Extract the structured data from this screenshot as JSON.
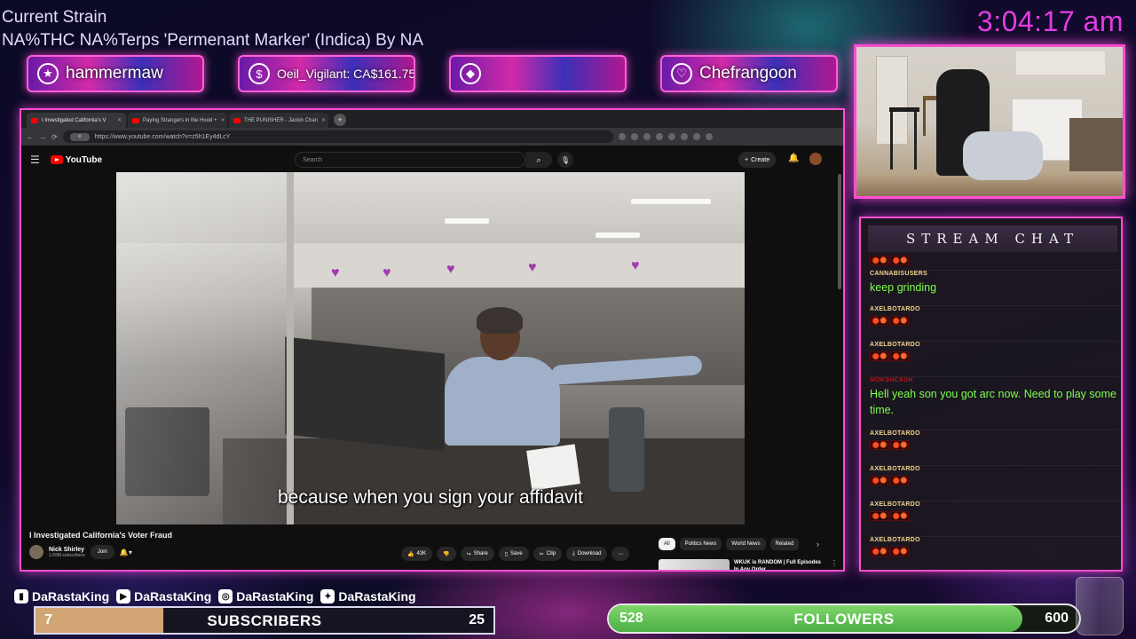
{
  "overlay": {
    "strain_title": "Current Strain",
    "strain_desc": "NA%THC NA%Terps 'Permenant Marker' (Indica) By NA",
    "clock": "3:04:17 am"
  },
  "alerts": [
    {
      "icon": "star-icon",
      "glyph": "★",
      "label": "hammermaw"
    },
    {
      "icon": "dollar-icon",
      "glyph": "$",
      "label": "Oeil_Vigilant: CA$161.75"
    },
    {
      "icon": "diamond-icon",
      "glyph": "◆",
      "label": ""
    },
    {
      "icon": "heart-icon",
      "glyph": "♡",
      "label": "Chefrangoon"
    }
  ],
  "browser": {
    "tabs": [
      {
        "label": "I Investigated California's V",
        "active": true
      },
      {
        "label": "Paying Strangers in the Hood +",
        "active": false
      },
      {
        "label": "THE PUNISHER - Jackin Chan",
        "active": false
      }
    ],
    "url": "https://www.youtube.com/watch?v=z5h1Ey4dLcY",
    "nav_back": "←",
    "nav_forward": "→",
    "nav_reload": "⟳"
  },
  "youtube": {
    "logo": "YouTube",
    "search_placeholder": "Search",
    "create_label": "Create",
    "subtitle": "because when you sign your affidavit",
    "video_title": "I Investigated California's Voter Fraud",
    "channel_name": "Nick Shirley",
    "channel_subs": "1.69M subscribers",
    "join_label": "Join",
    "likes": "43K",
    "share_label": "Share",
    "save_label": "Save",
    "clip_label": "Clip",
    "download_label": "Download",
    "chips": [
      "All",
      "Politics News",
      "World News",
      "Related"
    ],
    "reco_title": "WKUK is RANDOM | Full Episodes In Any Order"
  },
  "chat": {
    "title": "STREAM CHAT",
    "messages": [
      {
        "user": "CANNABISUSERS",
        "text": "keep grinding",
        "emotes": 0,
        "red": false
      },
      {
        "user": "AXELBOTARDO",
        "text": "",
        "emotes": 2,
        "red": false
      },
      {
        "user": "AXELBOTARDO",
        "text": "",
        "emotes": 2,
        "red": false
      },
      {
        "user": "MOKSHCASH",
        "text": "Hell yeah son you got arc now. Need to play some time.",
        "emotes": 0,
        "red": true
      },
      {
        "user": "AXELBOTARDO",
        "text": "",
        "emotes": 2,
        "red": false
      },
      {
        "user": "AXELBOTARDO",
        "text": "",
        "emotes": 2,
        "red": false
      },
      {
        "user": "AXELBOTARDO",
        "text": "",
        "emotes": 2,
        "red": false
      },
      {
        "user": "AXELBOTARDO",
        "text": "",
        "emotes": 2,
        "red": false
      }
    ]
  },
  "socials": [
    {
      "icon": "twitch-icon",
      "glyph": "▮",
      "label": "DaRastaKing"
    },
    {
      "icon": "youtube-icon",
      "glyph": "▶",
      "label": "DaRastaKing"
    },
    {
      "icon": "instagram-icon",
      "glyph": "◎",
      "label": "DaRastaKing"
    },
    {
      "icon": "twitter-icon",
      "glyph": "✦",
      "label": "DaRastaKing"
    }
  ],
  "subscribers": {
    "current": "7",
    "label": "SUBSCRIBERS",
    "goal": "25",
    "progress": 0.28
  },
  "followers": {
    "current": "528",
    "label": "FOLLOWERS",
    "goal": "600",
    "progress": 0.88
  },
  "colors": {
    "accent": "#ff4fd0",
    "clock": "#e13de0",
    "chat_text": "#7dff4e",
    "chat_user": "#f4d58d"
  }
}
